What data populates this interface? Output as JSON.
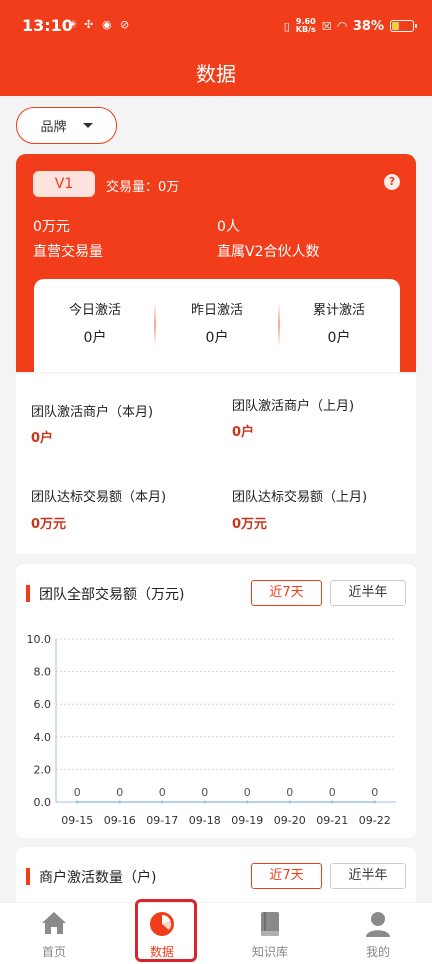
{
  "status_bar": {
    "time": "13:10",
    "net_speed_value": "9.60",
    "net_speed_unit": "KB/s",
    "battery_percent": "38%",
    "battery_level": 0.38
  },
  "page": {
    "title": "数据"
  },
  "filter": {
    "brand_label": "品牌"
  },
  "summary": {
    "level": "V1",
    "volume_label": "交易量：0万",
    "direct_value": "0万元",
    "direct_label": "直营交易量",
    "partners_value": "0人",
    "partners_label": "直属V2合伙人数"
  },
  "activation": [
    {
      "title": "今日激活",
      "value": "0户"
    },
    {
      "title": "昨日激活",
      "value": "0户"
    },
    {
      "title": "累计激活",
      "value": "0户"
    }
  ],
  "team_stats": [
    {
      "title": "团队激活商户（本月)",
      "value": "0户"
    },
    {
      "title": "团队激活商户（上月)",
      "value": "0户"
    },
    {
      "title": "团队达标交易额（本月)",
      "value": "0万元"
    },
    {
      "title": "团队达标交易额（上月)",
      "value": "0万元"
    }
  ],
  "transactions_section": {
    "title": "团队全部交易额（万元)",
    "range_7d": "近7天",
    "range_half_year": "近半年"
  },
  "chart_data": {
    "type": "line",
    "title": "",
    "xlabel": "",
    "ylabel": "",
    "categories": [
      "09-15",
      "09-16",
      "09-17",
      "09-18",
      "09-19",
      "09-20",
      "09-21",
      "09-22"
    ],
    "values": [
      0,
      0,
      0,
      0,
      0,
      0,
      0,
      0
    ],
    "ylim": [
      0,
      10
    ],
    "yticks": [
      "0.0",
      "2.0",
      "4.0",
      "6.0",
      "8.0",
      "10.0"
    ],
    "grid": true,
    "data_labels": [
      "0",
      "0",
      "0",
      "0",
      "0",
      "0",
      "0",
      "0"
    ],
    "line_color": "#9ec1e8"
  },
  "merchant_section": {
    "title": "商户激活数量（户)",
    "range_7d": "近7天",
    "range_half_year": "近半年"
  },
  "tabbar": {
    "home": "首页",
    "data": "数据",
    "knowledge": "知识库",
    "mine": "我的"
  },
  "colors": {
    "accent": "#f23d1b",
    "value_red": "#c8351d",
    "highlight": "#d9262d"
  }
}
